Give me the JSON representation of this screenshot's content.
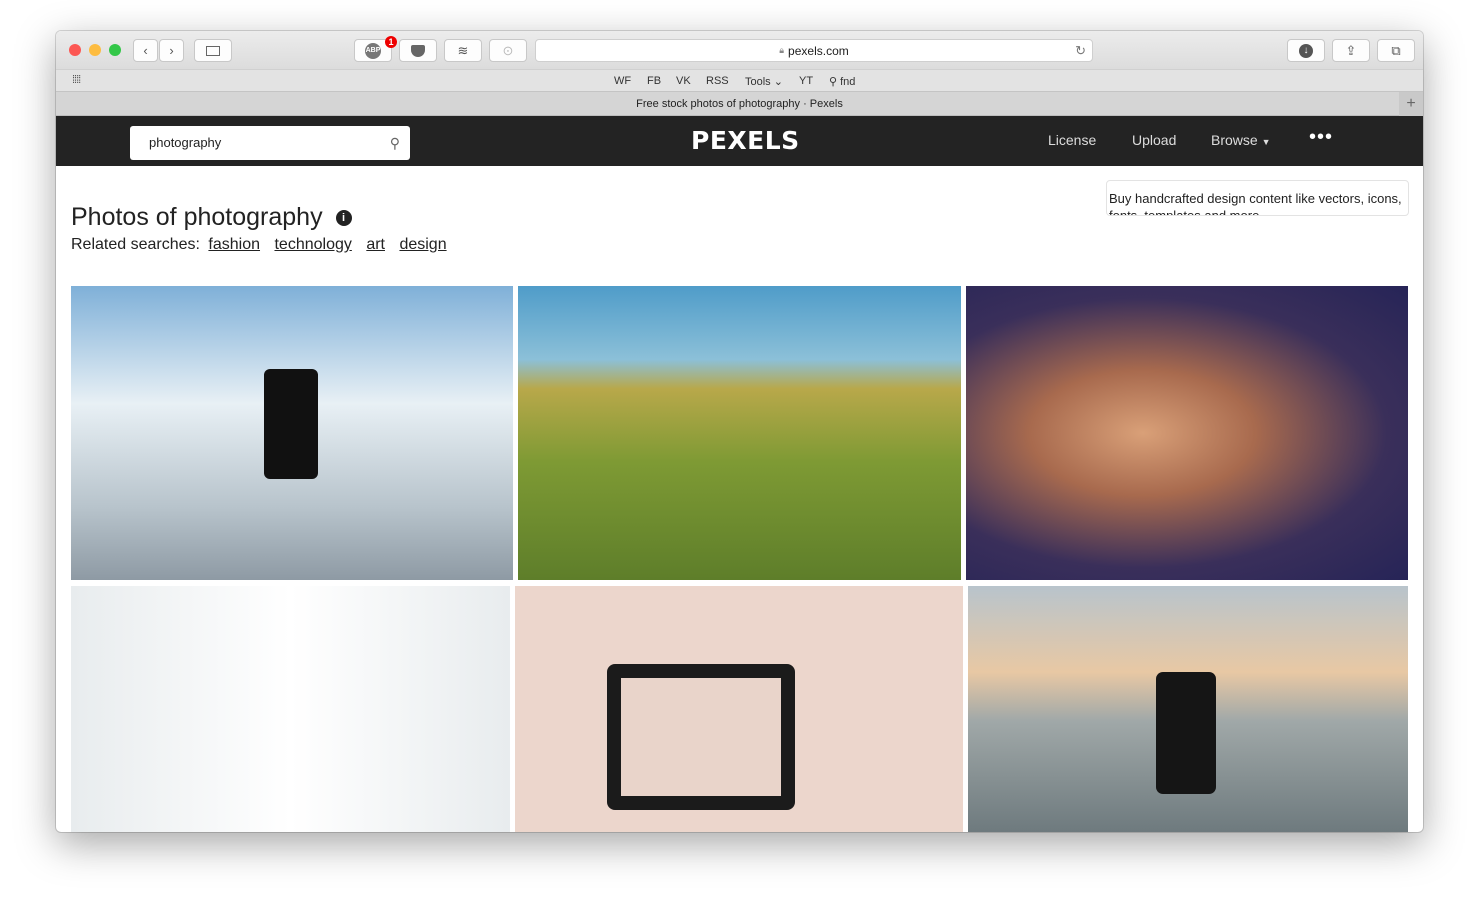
{
  "browser": {
    "url": "pexels.com",
    "tab_title": "Free stock photos of photography · Pexels",
    "abp_badge": "1",
    "abp_label": "ABP",
    "bookmarks": [
      "WF",
      "FB",
      "VK",
      "RSS",
      "Tools",
      "YT",
      "fnd"
    ]
  },
  "site": {
    "logo": "PEXELS",
    "search_value": "photography",
    "nav": [
      "License",
      "Upload",
      "Browse"
    ],
    "page_title": "Photos of photography",
    "related_label": "Related searches:",
    "related": [
      "fashion",
      "technology",
      "art",
      "design"
    ],
    "ad_text": "Buy handcrafted design content like vectors, icons, fonts, templates and more."
  },
  "photos": [
    {
      "subject": "hand holding phone over city",
      "colors": [
        "#dfeaf2",
        "#9fb3c4"
      ]
    },
    {
      "subject": "family in grass field",
      "colors": [
        "#5aa0c8",
        "#8a9a38"
      ]
    },
    {
      "subject": "woman with red lips",
      "colors": [
        "#2a2a5e",
        "#b07a5a"
      ]
    },
    {
      "subject": "studio lights",
      "colors": [
        "#f4f6f7",
        "#d8dde0"
      ]
    },
    {
      "subject": "tablet and cameras on table",
      "colors": [
        "#e8d0c6",
        "#2a2a2a"
      ]
    },
    {
      "subject": "phone at sunset sea",
      "colors": [
        "#e4c8a6",
        "#6a7a82"
      ]
    }
  ]
}
